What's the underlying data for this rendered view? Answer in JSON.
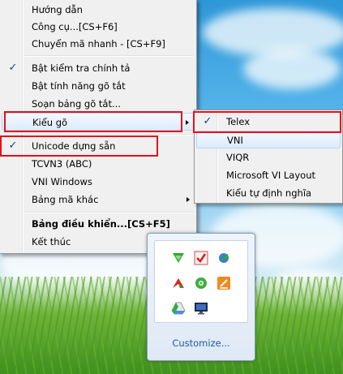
{
  "main_menu": {
    "items": [
      {
        "label": "Hướng dẫn"
      },
      {
        "label": "Công cụ...[CS+F6]"
      },
      {
        "label": "Chuyển mã nhanh - [CS+F9]"
      },
      {
        "label": "Bật kiểm tra chính tả",
        "checked": true
      },
      {
        "label": "Bật tính năng gõ tắt"
      },
      {
        "label": "Soạn bảng gõ tắt..."
      },
      {
        "label": "Kiểu gõ",
        "submenu": true
      },
      {
        "label": "Unicode dựng sẵn",
        "checked": true
      },
      {
        "label": "TCVN3 (ABC)"
      },
      {
        "label": "VNI Windows"
      },
      {
        "label": "Bảng mã khác",
        "submenu": true
      },
      {
        "label": "Bảng điều khiển...[CS+F5]",
        "bold": true
      },
      {
        "label": "Kết thúc"
      }
    ]
  },
  "submenu": {
    "items": [
      {
        "label": "Telex",
        "checked": true
      },
      {
        "label": "VNI"
      },
      {
        "label": "VIQR"
      },
      {
        "label": "Microsoft VI Layout"
      },
      {
        "label": "Kiểu tự định nghĩa"
      }
    ]
  },
  "tray": {
    "customize_label": "Customize...",
    "icons": [
      "wifi-signal-icon",
      "checkmark-app-icon",
      "globe-arrow-icon",
      "red-arrow-icon",
      "green-disc-icon",
      "orange-edit-icon",
      "drive-icon",
      "monitor-icon"
    ]
  },
  "colors": {
    "highlight_box": "#e3121b",
    "check": "#1a3f8a",
    "link": "#1e5aa8"
  },
  "check_glyph": "✓"
}
